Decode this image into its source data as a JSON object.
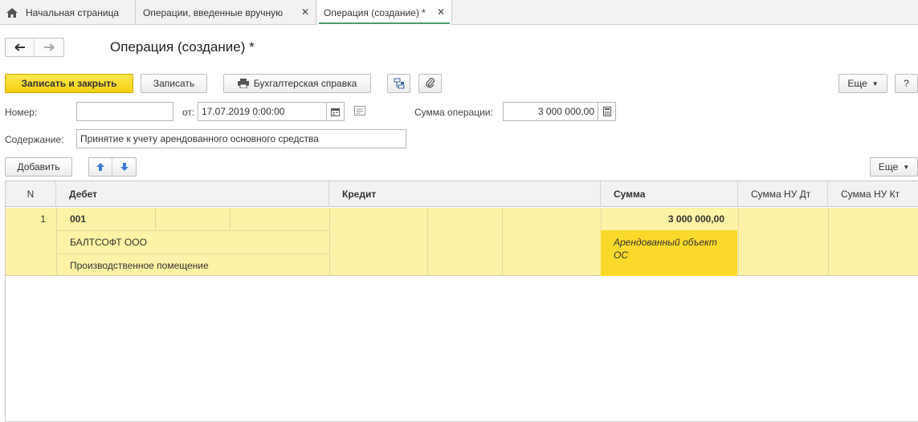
{
  "tabs": [
    {
      "label": "Начальная страница",
      "icon": "home-icon"
    },
    {
      "label": "Операции, введенные вручную",
      "close": "✕"
    },
    {
      "label": "Операция (создание) *",
      "close": "✕",
      "active": true
    }
  ],
  "form": {
    "title": "Операция (создание) *"
  },
  "toolbar": {
    "save_close_label": "Записать и закрыть",
    "save_label": "Записать",
    "print_label": "Бухгалтерская справка",
    "more_label": "Еще",
    "help_label": "?"
  },
  "fields": {
    "number_label": "Номер:",
    "number_value": "",
    "date_label": "от:",
    "date_value": "17.07.2019  0:00:00",
    "amount_label": "Сумма операции:",
    "amount_value": "3 000 000,00",
    "content_label": "Содержание:",
    "content_value": "Принятие к учету арендованного основного средства"
  },
  "table_toolbar": {
    "add_label": "Добавить",
    "more_label": "Еще"
  },
  "table": {
    "columns": [
      "N",
      "Дебет",
      "Кредит",
      "Сумма",
      "Сумма НУ Дт",
      "Сумма НУ Кт"
    ],
    "rows": [
      {
        "n": "1",
        "debit_account": "001",
        "debit_subconto1": "БАЛТСОФТ ООО",
        "debit_subconto2": "Производственное помещение",
        "amount": "3 000 000,00",
        "amount_note": "Арендованный объект ОС"
      }
    ]
  },
  "colors": {
    "accent_yellow": "#f5cf10",
    "row_highlight": "#fdf2a5",
    "cell_highlight": "#fbd92a",
    "active_tab_underline": "#4c9a69"
  }
}
